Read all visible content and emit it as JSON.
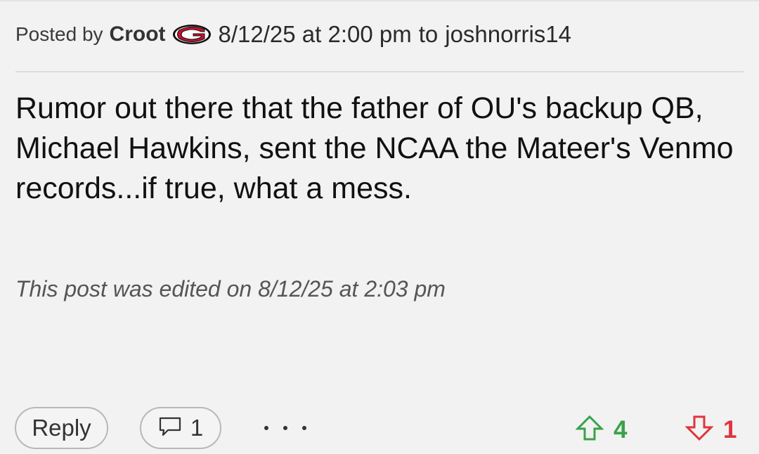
{
  "post": {
    "posted_by_label": "Posted by",
    "author": "Croot",
    "team_logo_icon": "georgia-g-logo-icon",
    "timestamp": "8/12/25 at 2:00 pm",
    "to_label": "to",
    "recipient": "joshnorris14",
    "body": "Rumor out there that the father of OU's backup QB, Michael Hawkins, sent the NCAA the Mateer's Venmo records...if true, what a mess.",
    "edited_note": "This post was edited on 8/12/25 at 2:03 pm"
  },
  "actions": {
    "reply_label": "Reply",
    "comment_count": "1",
    "comment_icon": "comment-bubble-icon",
    "more_icon": "more-options-icon"
  },
  "votes": {
    "upvote_icon": "up-arrow-icon",
    "upvote_count": "4",
    "upvote_color": "#3aa14a",
    "downvote_icon": "down-arrow-icon",
    "downvote_count": "1",
    "downvote_color": "#e0343c"
  }
}
